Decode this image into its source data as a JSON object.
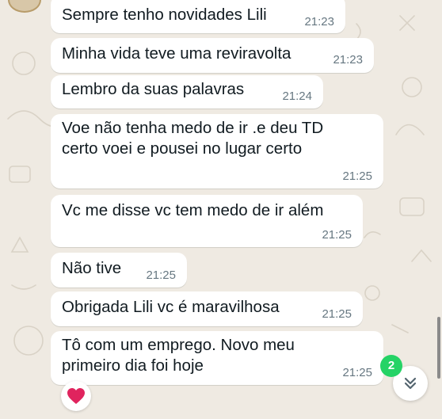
{
  "messages": [
    {
      "text": "Sempre tenho novidades Lili",
      "time": "21:23"
    },
    {
      "text": "Minha vida teve uma reviravolta",
      "time": "21:23"
    },
    {
      "text": "Lembro da suas palavras",
      "time": "21:24"
    },
    {
      "text": "Voe não tenha medo de ir .e deu TD\ncerto voei e pousei no lugar certo",
      "time": "21:25"
    },
    {
      "text": "Vc me disse vc tem medo de ir além",
      "time": "21:25"
    },
    {
      "text": "Não tive",
      "time": "21:25"
    },
    {
      "text": "Obrigada Lili vc é maravilhosa",
      "time": "21:25"
    },
    {
      "text": "Tô com um emprego. Novo meu\nprimeiro dia foi hoje",
      "time": "21:25"
    }
  ],
  "reaction": {
    "icon": "heart-emoji",
    "color": "#e0245e"
  },
  "scroll_button": {
    "icon": "double-chevron-down-icon",
    "unread_count": "2",
    "badge_color": "#25d366"
  },
  "theme": {
    "background": "#efeae2",
    "bubble": "#ffffff",
    "text": "#111b21",
    "timestamp": "#667781"
  }
}
